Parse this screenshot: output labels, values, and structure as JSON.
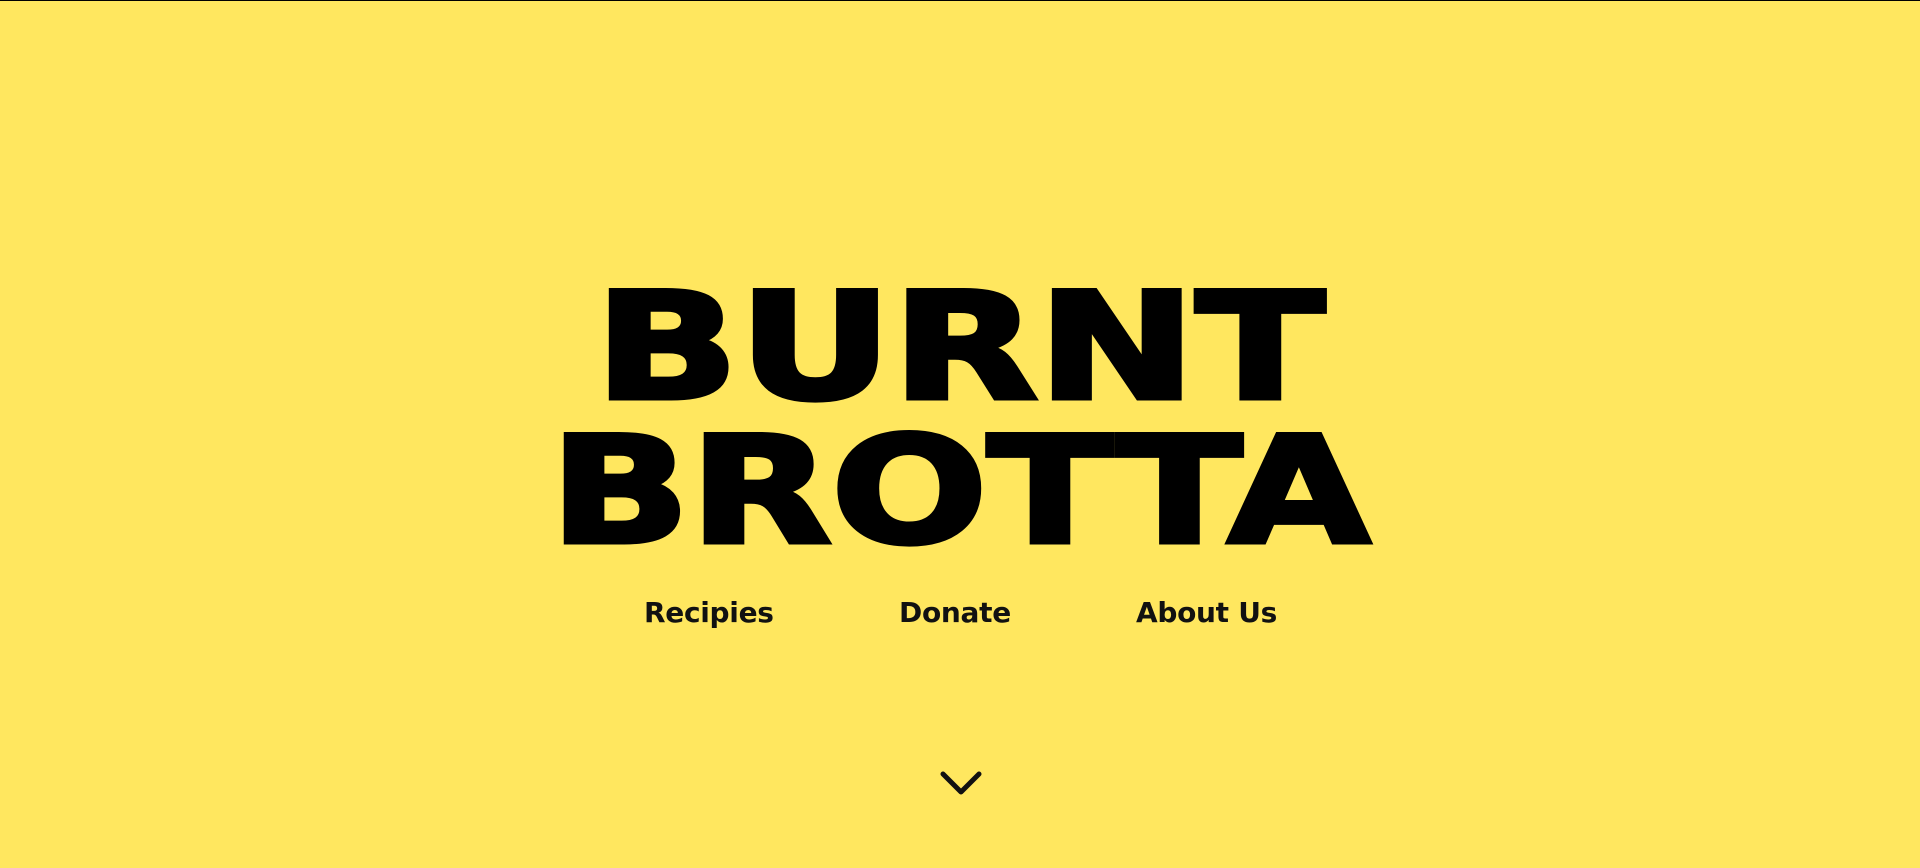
{
  "colors": {
    "background": "#FFE75F",
    "text": "#000000",
    "nav_text": "#111111"
  },
  "hero": {
    "title_line_1": "BURNT",
    "title_line_2": "BROTTA"
  },
  "nav": {
    "items": [
      {
        "label": "Recipies"
      },
      {
        "label": "Donate"
      },
      {
        "label": "About Us"
      }
    ]
  },
  "scroll_indicator": {
    "icon": "chevron-down-icon"
  }
}
